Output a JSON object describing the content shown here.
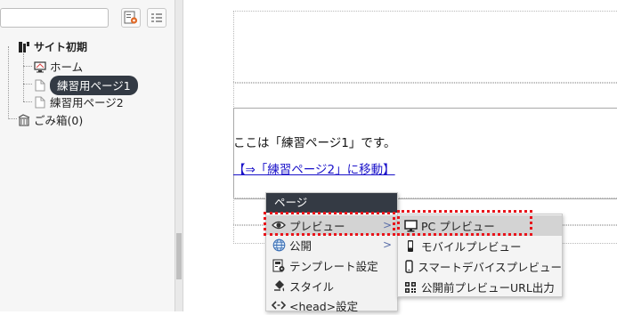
{
  "sidebar": {
    "search": {
      "value": "",
      "placeholder": ""
    },
    "tree": {
      "site": "サイト初期",
      "home": "ホーム",
      "page1": "練習用ページ1",
      "page2": "練習用ページ2",
      "trash": "ごみ箱(0)"
    }
  },
  "preview": {
    "paragraph": "ここは「練習ページ1」です。",
    "link": "【⇒「練習ページ2」に移動】"
  },
  "context_menu": {
    "header": "ページ",
    "items": [
      {
        "label": "プレビュー",
        "icon": "eye-icon",
        "submenu_arrow": ">"
      },
      {
        "label": "公開",
        "icon": "globe-icon",
        "submenu_arrow": ">"
      },
      {
        "label": "テンプレート設定",
        "icon": "template-icon"
      },
      {
        "label": "スタイル",
        "icon": "paint-bucket-icon"
      },
      {
        "label": "<head>設定",
        "icon": "code-icon"
      }
    ]
  },
  "preview_submenu": {
    "items": [
      {
        "label": "PC プレビュー",
        "icon": "monitor-icon"
      },
      {
        "label": "モバイルプレビュー",
        "icon": "mobile-icon"
      },
      {
        "label": "スマートデバイスプレビュー",
        "icon": "smart-device-icon"
      },
      {
        "label": "公開前プレビューURL出力",
        "icon": "qr-code-icon"
      }
    ]
  },
  "colors": {
    "highlight": "#e8141b",
    "menu_header_bg": "#343a44",
    "selected_bg": "#333a44",
    "link": "#1a12c9"
  }
}
